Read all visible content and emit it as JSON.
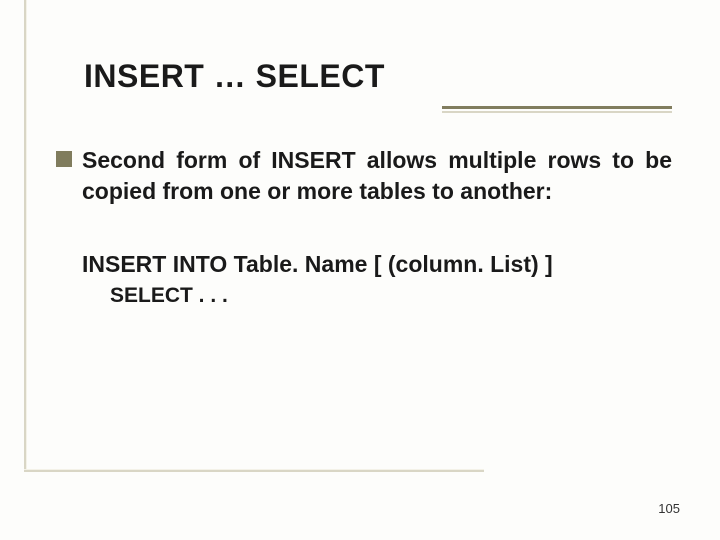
{
  "slide": {
    "title": "INSERT … SELECT",
    "bullet_1": "Second form of INSERT allows multiple rows to be copied from one or more tables to another:",
    "code_line_1": "INSERT INTO Table. Name [ (column. List) ]",
    "code_line_2": "SELECT . . .",
    "page_number": "105"
  }
}
